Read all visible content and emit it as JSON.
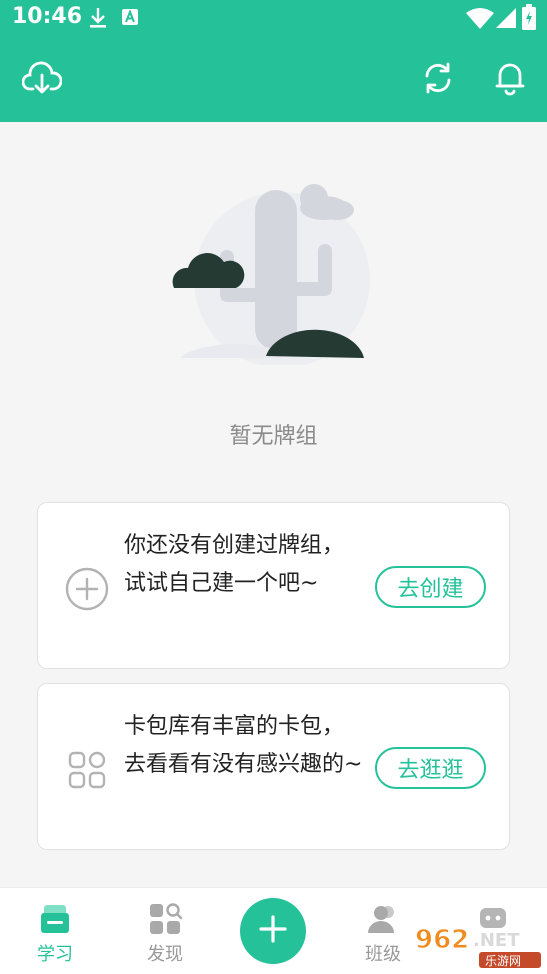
{
  "status_bar": {
    "time": "10:46",
    "icons": [
      "download-icon",
      "a-badge-icon",
      "wifi-icon",
      "signal-icon",
      "battery-icon"
    ]
  },
  "toolbar": {
    "left_icon": "cloud-download-icon",
    "right_icons": [
      "sync-icon",
      "bell-icon"
    ],
    "color": "#25c29a"
  },
  "empty_state": {
    "text": "暂无牌组"
  },
  "cards": [
    {
      "icon": "plus-circle-icon",
      "text": "你还没有创建过牌组，试试自己建一个吧~",
      "button": "去创建"
    },
    {
      "icon": "grid-icon",
      "text": "卡包库有丰富的卡包，去看看有没有感兴趣的~",
      "button": "去逛逛"
    }
  ],
  "bottom_nav": {
    "items": [
      {
        "label": "学习",
        "icon": "study-icon",
        "active": true
      },
      {
        "label": "发现",
        "icon": "discover-icon",
        "active": false
      },
      {
        "label": "",
        "icon": "add-icon",
        "active": false
      },
      {
        "label": "班级",
        "icon": "class-icon",
        "active": false
      },
      {
        "label": "",
        "icon": "me-icon",
        "active": false
      }
    ]
  },
  "watermark": {
    "brand": "962.NET",
    "sub": "乐游网"
  }
}
